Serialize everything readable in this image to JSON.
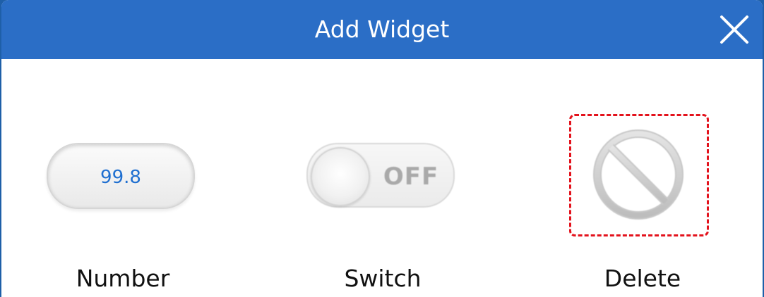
{
  "dialog": {
    "title": "Add Widget",
    "close_icon": "close-icon"
  },
  "widgets": [
    {
      "id": "number",
      "preview_value": "99.8",
      "label": "Number"
    },
    {
      "id": "switch",
      "preview_state": "OFF",
      "label": "Switch"
    },
    {
      "id": "delete",
      "icon": "prohibited-icon",
      "label": "Delete",
      "selected": true
    }
  ],
  "colors": {
    "titlebar": "#2b6ec6",
    "number_text": "#1f6fd0",
    "selection_border": "#e3121c"
  }
}
